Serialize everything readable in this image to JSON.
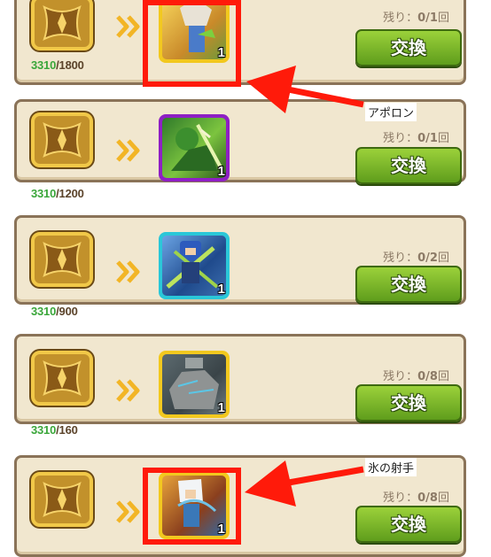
{
  "rows": [
    {
      "score_have": "3310",
      "score_sep": "/",
      "score_need": "1800",
      "item_frame_color": "#f2c81e",
      "item_art": "hero-blonde-sage",
      "qty": "1",
      "remain_prefix": "残り：",
      "remain_value": "0/1",
      "remain_suffix": "回",
      "exchange_label": "交換"
    },
    {
      "score_have": "3310",
      "score_sep": "/",
      "score_need": "1200",
      "item_frame_color": "#8e1fc4",
      "item_art": "hero-green-warrior",
      "qty": "1",
      "remain_prefix": "残り：",
      "remain_value": "0/1",
      "remain_suffix": "回",
      "exchange_label": "交換"
    },
    {
      "score_have": "3310",
      "score_sep": "/",
      "score_need": "900",
      "item_frame_color": "#2ac7d8",
      "item_art": "hero-blue-knight",
      "qty": "1",
      "remain_prefix": "残り：",
      "remain_value": "0/2",
      "remain_suffix": "回",
      "exchange_label": "交換"
    },
    {
      "score_have": "3310",
      "score_sep": "/",
      "score_need": "160",
      "item_frame_color": "#f2c81e",
      "item_art": "stone-golem",
      "qty": "1",
      "remain_prefix": "残り：",
      "remain_value": "0/8",
      "remain_suffix": "回",
      "exchange_label": "交換"
    },
    {
      "score_have": "",
      "score_sep": "",
      "score_need": "",
      "item_frame_color": "#f2c81e",
      "item_art": "hero-ice-archer",
      "qty": "1",
      "remain_prefix": "残り：",
      "remain_value": "0/8",
      "remain_suffix": "回",
      "exchange_label": "交換"
    }
  ],
  "annotations": {
    "apollo": "アポロン",
    "ice_archer": "氷の射手"
  },
  "colors": {
    "card_bg": "#f1e7cf",
    "button_green": "#7bb82a",
    "highlight_red": "#ff1a0a",
    "score_have": "#3aa63a"
  }
}
